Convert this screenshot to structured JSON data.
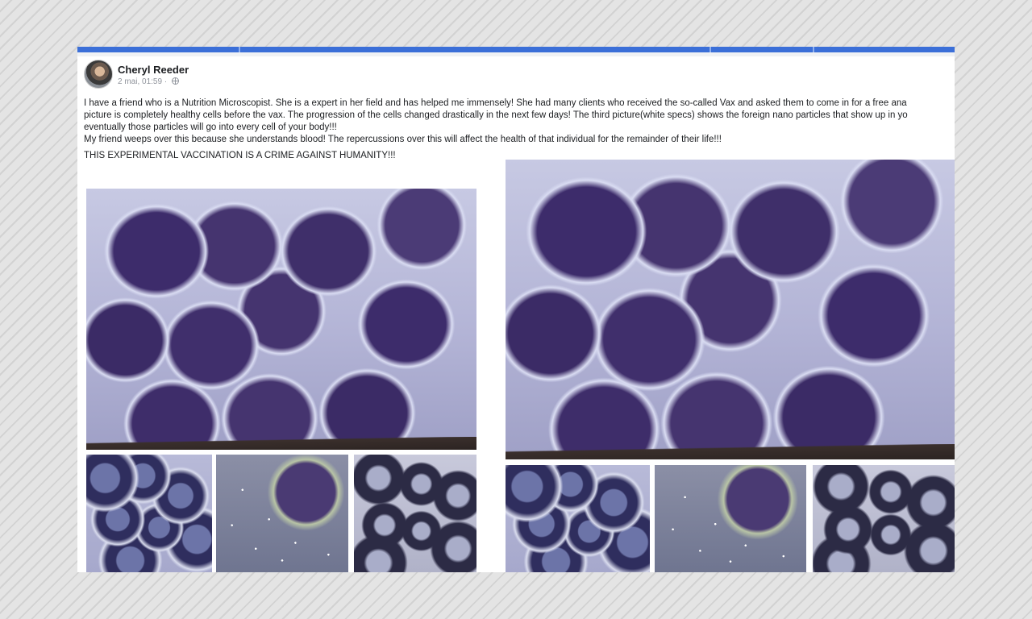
{
  "post": {
    "author": "Cheryl Reeder",
    "timestamp": "2 mai, 01:59 ·",
    "privacy_icon": "globe-icon",
    "lines": [
      "I have a friend who is a Nutrition Microscopist. She is a expert in her field and has helped me immensely! She had many clients who received the so-called Vax and asked them to come in for a free ana",
      "picture is completely healthy cells before the vax. The progression of the cells changed drastically in the next few days! The third picture(white specs) shows the foreign nano particles that show up in yo",
      "eventually those particles will go into every cell of your body!!!",
      "My friend weeps over this because she understands blood! The repercussions over this will affect the health of that individual for the remainder of their life!!!"
    ],
    "shout": "THIS EXPERIMENTAL VACCINATION IS A CRIME AGAINST HUMANITY!!!"
  },
  "colors": {
    "accent_bar": "#3b6fd8",
    "text": "#1c1e21",
    "meta": "#90949c"
  }
}
